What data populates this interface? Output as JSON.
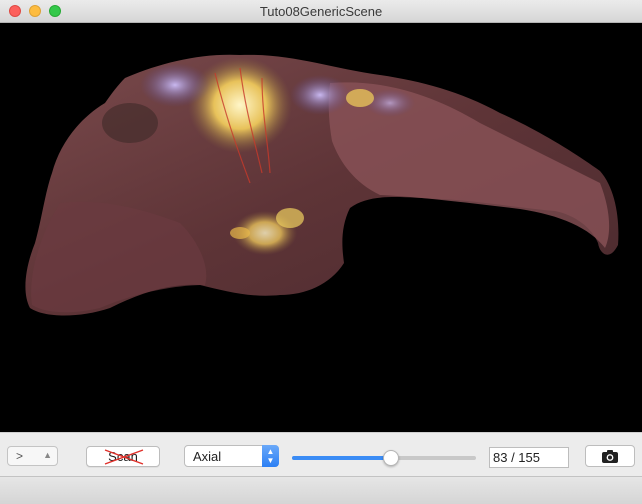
{
  "window": {
    "title": "Tuto08GenericScene"
  },
  "toolbar": {
    "mode_popup": {
      "value": ">",
      "icon": "chevron-updown-icon"
    },
    "scan_button": {
      "label": "Scan",
      "icon": "strikethrough-cross-icon",
      "cross_color": "#e0302a"
    },
    "orientation_select": {
      "value": "Axial",
      "icon": "chevron-updown-icon",
      "accent": "#3b8cf5"
    },
    "slice_slider": {
      "value": 83,
      "max": 155
    },
    "slice_counter": {
      "text": "83 / 155"
    },
    "snapshot_button": {
      "icon": "camera-icon"
    }
  },
  "scene": {
    "background": "#000000",
    "content": "textured-3d-mesh"
  }
}
